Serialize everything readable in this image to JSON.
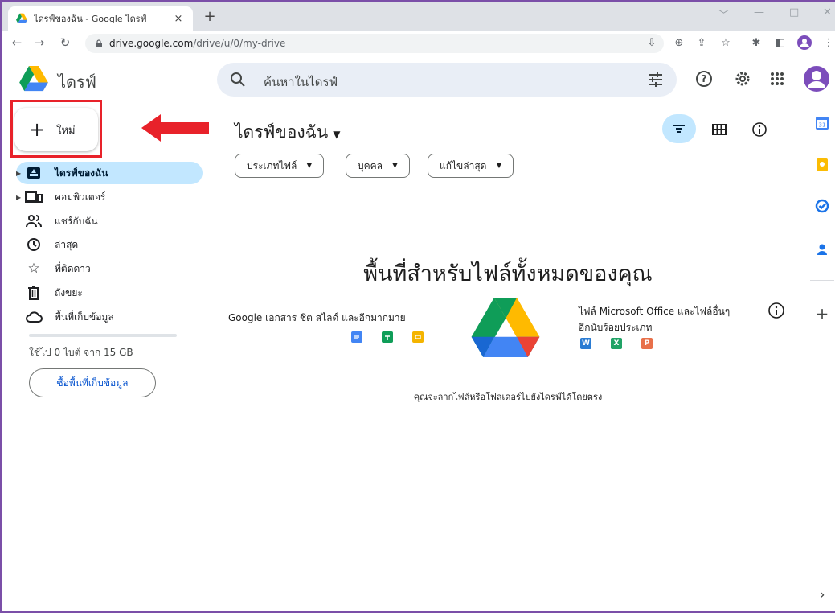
{
  "browser": {
    "tab_title": "ไดรฟ์ของฉัน - Google ไดรฟ์",
    "tab_close": "×",
    "new_tab": "+",
    "url_host": "drive.google.com",
    "url_path": "/drive/u/0/my-drive",
    "window_controls": [
      "﹀",
      "—",
      "□",
      "✕"
    ]
  },
  "header": {
    "brand": "ไดรฟ์",
    "search_placeholder": "ค้นหาในไดรฟ์"
  },
  "sidebar": {
    "new_label": "ใหม่",
    "items": [
      {
        "label": "ไดรฟ์ของฉัน",
        "icon": "my-drive-icon",
        "active": true,
        "caret": true
      },
      {
        "label": "คอมพิวเตอร์",
        "icon": "computers-icon",
        "active": false,
        "caret": true
      },
      {
        "label": "แชร์กับฉัน",
        "icon": "shared-icon",
        "active": false,
        "caret": false
      },
      {
        "label": "ล่าสุด",
        "icon": "clock-icon",
        "active": false,
        "caret": false
      },
      {
        "label": "ที่ติดดาว",
        "icon": "star-icon",
        "active": false,
        "caret": false
      },
      {
        "label": "ถังขยะ",
        "icon": "trash-icon",
        "active": false,
        "caret": false
      },
      {
        "label": "พื้นที่เก็บข้อมูล",
        "icon": "cloud-icon",
        "active": false,
        "caret": false
      }
    ],
    "storage_used_fraction": 0,
    "storage_text": "ใช้ไป 0 ไบต์ จาก 15 GB",
    "buy_storage": "ซื้อพื้นที่เก็บข้อมูล"
  },
  "main": {
    "title": "ไดรฟ์ของฉัน",
    "filters": [
      "ประเภทไฟล์",
      "บุคคล",
      "แก้ไขล่าสุด"
    ],
    "empty_heading": "พื้นที่สำหรับไฟล์ทั้งหมดของคุณ",
    "google_docs_text": "Google เอกสาร ชีต สไลด์ และอีกมากมาย",
    "ms_text_line1": "ไฟล์ Microsoft Office และไฟล์อื่นๆ",
    "ms_text_line2": "อีกนับร้อยประเภท",
    "ms_letters": [
      "W",
      "X",
      "P"
    ],
    "drop_text": "คุณจะลากไฟล์หรือโฟลเดอร์ไปยังไดรฟ์ได้โดยตรง"
  },
  "side_panel": {
    "calendar_date": "31",
    "add": "+",
    "expand": "›"
  },
  "colors": {
    "accent": "#0b57d0",
    "active_nav": "#c2e7ff",
    "highlight_red": "#e8222a",
    "docs_blue": "#4285f4",
    "sheets_green": "#0f9d58",
    "slides_yellow": "#f4b400",
    "word_blue": "#2b7cd3",
    "excel_green": "#21a366",
    "ppt_orange": "#e8704a"
  }
}
